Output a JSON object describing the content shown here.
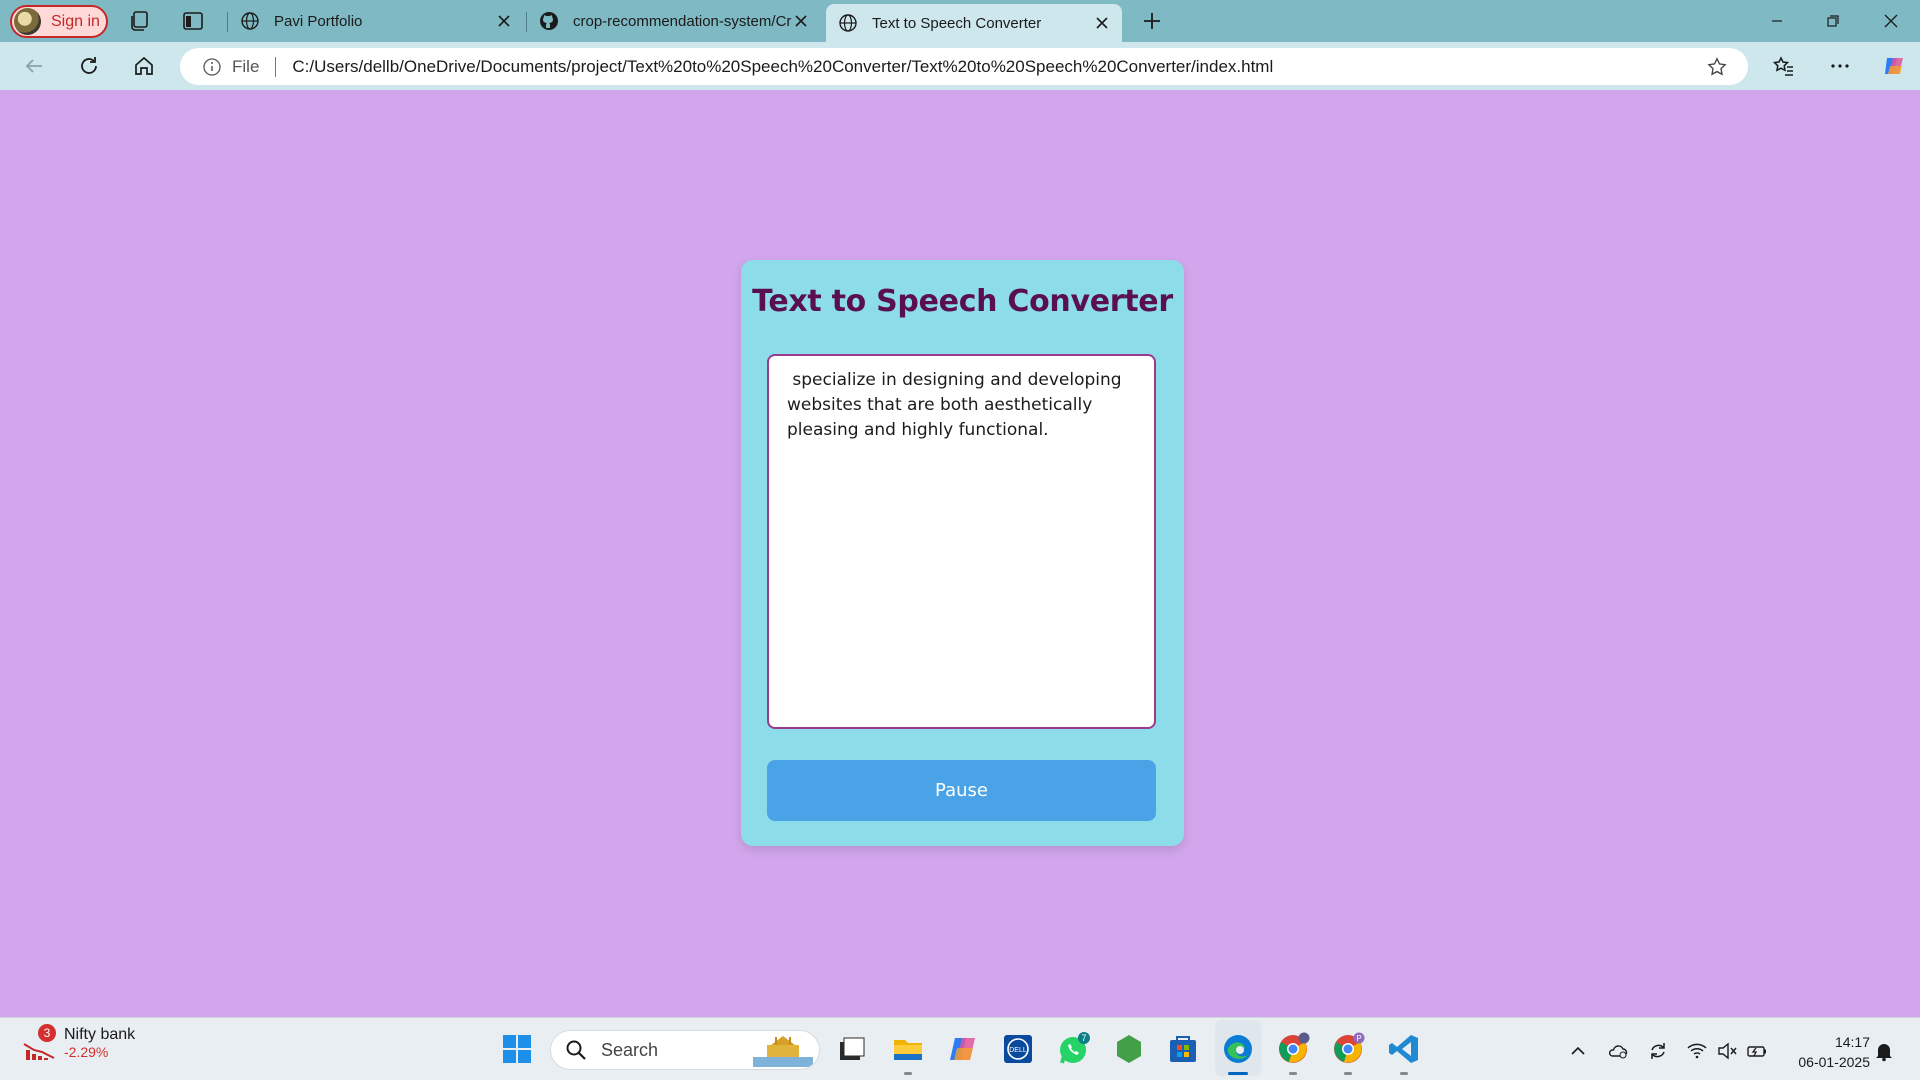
{
  "browser": {
    "signin_label": "Sign in",
    "tabs": [
      {
        "title": "Pavi Portfolio",
        "icon": "globe-icon",
        "active": false
      },
      {
        "title": "crop-recommendation-system/Cr",
        "icon": "github-icon",
        "active": false
      },
      {
        "title": "Text to Speech Converter",
        "icon": "globe-icon",
        "active": true
      }
    ],
    "address": {
      "scheme_label": "File",
      "url": "C:/Users/dellb/OneDrive/Documents/project/Text%20to%20Speech%20Converter/Text%20to%20Speech%20Converter/index.html"
    }
  },
  "page": {
    "background_color": "#d2a6ec",
    "card_color": "#8ddce9",
    "title": "Text to Speech Converter",
    "textarea_value": " specialize in designing and developing websites that are both aesthetically pleasing and highly functional.",
    "button_label": "Pause",
    "button_color": "#4aa3e6",
    "title_color": "#5a1050"
  },
  "taskbar": {
    "widget": {
      "name": "Nifty bank",
      "value": "-2.29%",
      "badge": "3"
    },
    "search_label": "Search",
    "whatsapp_badge": "7",
    "chrome_profile_badge": "P",
    "clock": {
      "time": "14:17",
      "date": "06-01-2025"
    }
  }
}
